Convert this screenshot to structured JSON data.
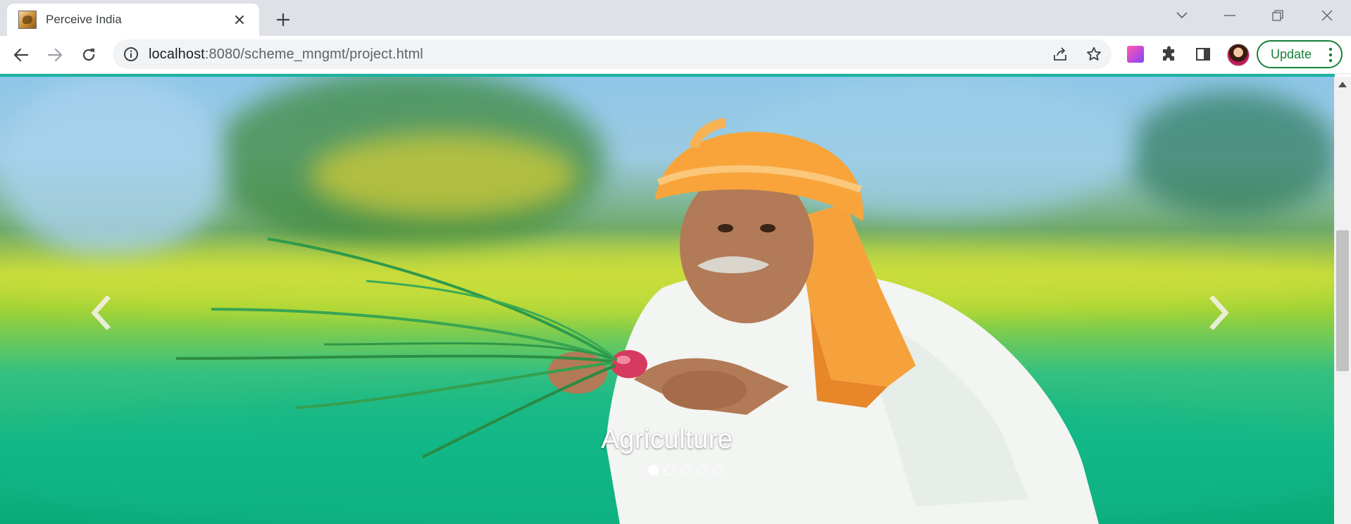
{
  "browser": {
    "tab": {
      "title": "Perceive India",
      "favicon": "tiger-favicon-icon",
      "close_icon": "close-icon"
    },
    "new_tab_icon": "plus-icon",
    "window_controls": [
      "chevron-down-icon",
      "minimize-icon",
      "restore-icon",
      "close-icon"
    ],
    "address": {
      "host": "localhost",
      "path": ":8080/scheme_mngmt/project.html"
    },
    "update_label": "Update",
    "accent_color": "#19b3a0"
  },
  "carousel": {
    "caption": "Agriculture",
    "slide_count": 5,
    "active_index": 0,
    "prev_icon": "chevron-left-icon",
    "next_icon": "chevron-right-icon"
  }
}
